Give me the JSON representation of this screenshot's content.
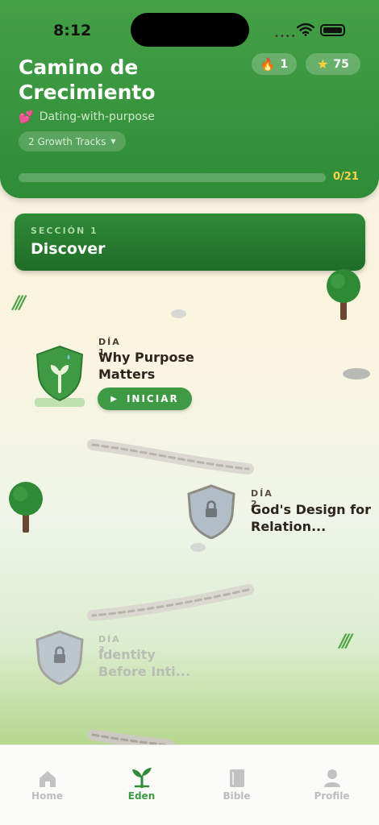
{
  "status_bar": {
    "time": "8:12"
  },
  "header": {
    "title": "Camino de Crecimiento",
    "subtitle": "Dating-with-purpose",
    "tracks_label": "2 Growth Tracks",
    "streak_count": "1",
    "stars_count": "75",
    "progress_label": "0/21",
    "progress_fraction": 0
  },
  "section": {
    "kicker": "SECCIÓN 1",
    "name": "Discover"
  },
  "lessons": [
    {
      "day": "DÍA 1",
      "title": "Why Purpose Matters",
      "state": "current",
      "action_label": "INICIAR"
    },
    {
      "day": "DÍA 2",
      "title": "God's Design for Relation...",
      "state": "locked"
    },
    {
      "day": "DÍA 3",
      "title": "Identity Before Inti...",
      "state": "locked"
    }
  ],
  "tabbar": {
    "tabs": [
      {
        "label": "Home",
        "icon": "home-icon"
      },
      {
        "label": "Eden",
        "icon": "sprout-icon",
        "active": true
      },
      {
        "label": "Bible",
        "icon": "book-icon"
      },
      {
        "label": "Profile",
        "icon": "person-icon"
      }
    ]
  },
  "colors": {
    "brand_green": "#3e9a43",
    "accent_gold": "#ffd54a",
    "header_green": "#45a046"
  }
}
